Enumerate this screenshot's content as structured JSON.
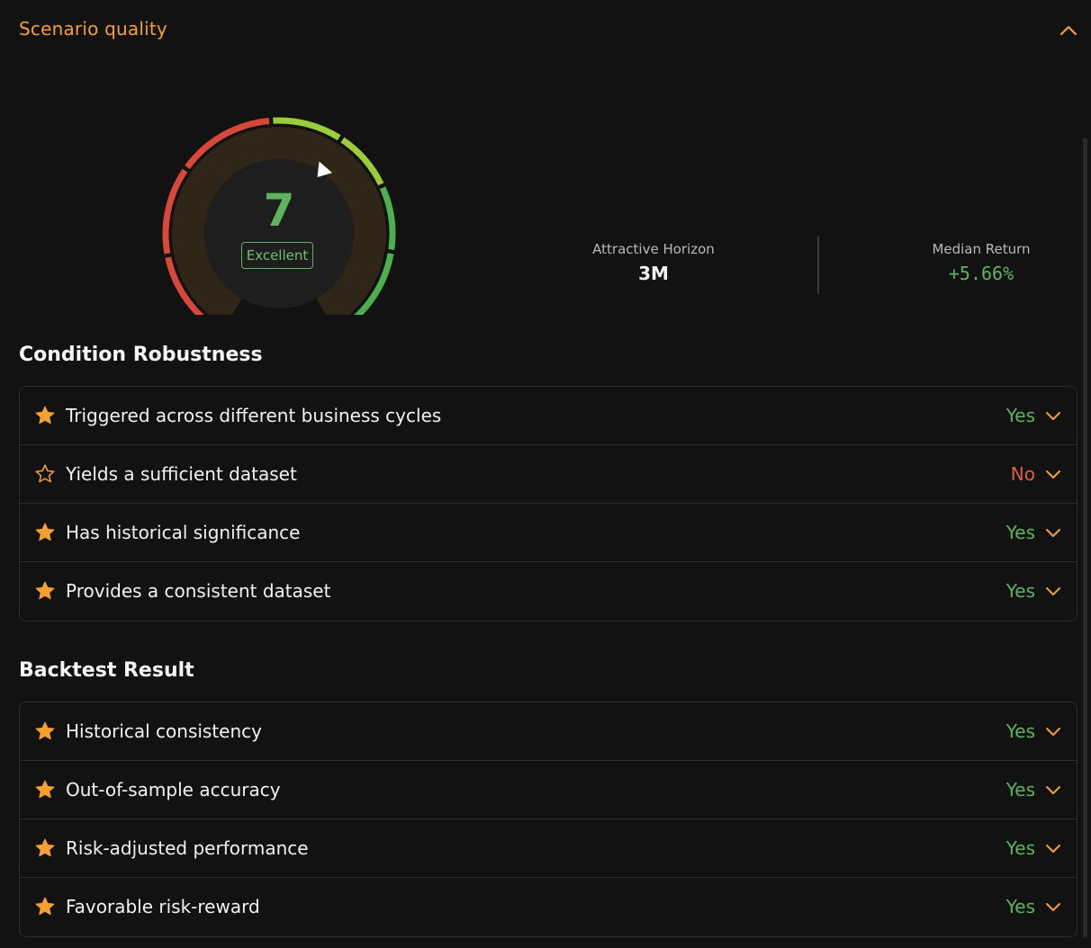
{
  "header": {
    "title": "Scenario quality",
    "collapse_icon": "chevron-up-icon"
  },
  "gauge": {
    "score": "7",
    "rating": "Excellent",
    "score_value": 7,
    "score_max": 10
  },
  "stats": [
    {
      "label": "Attractive Horizon",
      "value": "3M"
    },
    {
      "label": "Median Return",
      "value": "+5.66%"
    }
  ],
  "condition": {
    "title": "Condition Robustness",
    "rows": [
      {
        "label": "Triggered across different business cycles",
        "answer": "Yes",
        "star": "filled"
      },
      {
        "label": "Yields a sufficient dataset",
        "answer": "No",
        "star": "outline"
      },
      {
        "label": "Has historical significance",
        "answer": "Yes",
        "star": "filled"
      },
      {
        "label": "Provides a consistent dataset",
        "answer": "Yes",
        "star": "filled"
      }
    ]
  },
  "backtest": {
    "title": "Backtest Result",
    "rows": [
      {
        "label": "Historical consistency",
        "answer": "Yes",
        "star": "filled"
      },
      {
        "label": "Out-of-sample accuracy",
        "answer": "Yes",
        "star": "filled"
      },
      {
        "label": "Risk-adjusted performance",
        "answer": "Yes",
        "star": "filled"
      },
      {
        "label": "Favorable risk-reward",
        "answer": "Yes",
        "star": "filled"
      }
    ]
  },
  "colors": {
    "accent": "#f5a030",
    "yes": "#5fb35f",
    "no": "#e06040",
    "gauge_red": "#d9473a",
    "gauge_lime": "#9ccc3a",
    "gauge_green": "#4caf50"
  }
}
